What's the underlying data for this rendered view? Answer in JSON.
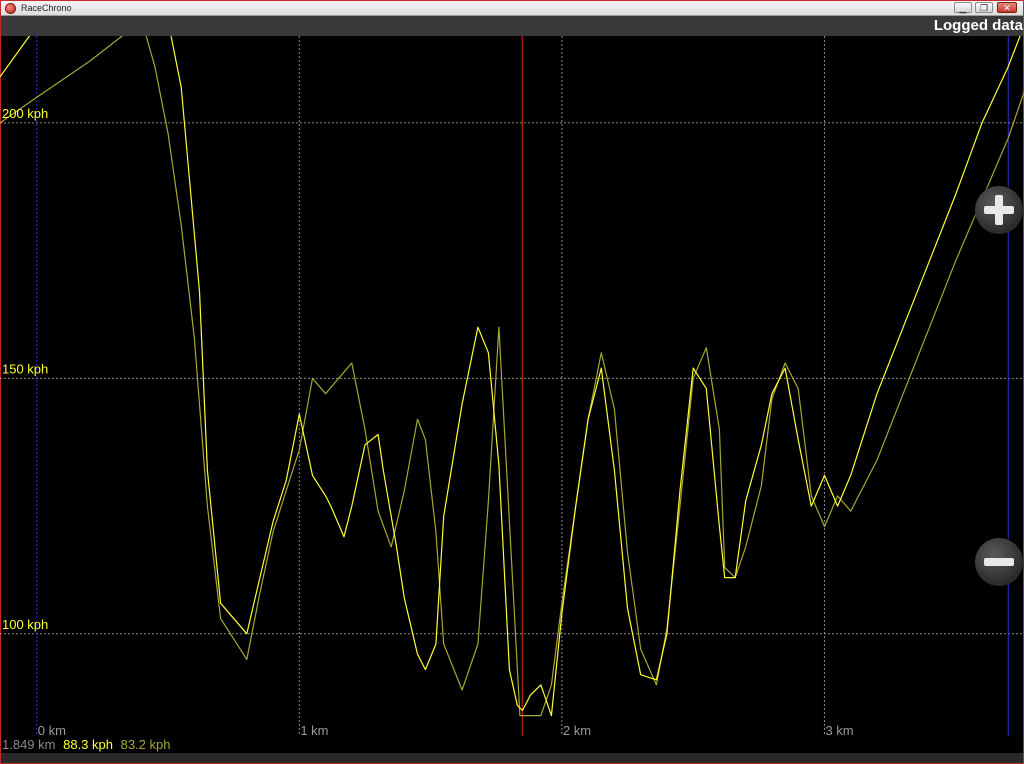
{
  "window": {
    "title": "RaceChrono",
    "minimize_glyph": "▁",
    "restore_glyph": "❐",
    "close_glyph": "✕"
  },
  "header": {
    "title": "Logged data"
  },
  "readout": {
    "distance": "1.849 km",
    "speed_current": "88.3 kph",
    "speed_compare": "83.2 kph"
  },
  "zoom": {
    "in_icon": "plus-icon",
    "out_icon": "minus-icon"
  },
  "colors": {
    "primary_trace": "#ffff33",
    "compare_trace": "#a7a734",
    "cursor": "#e52a1a",
    "lap_marker": "#2b33d0",
    "grid": "#8c8c8c"
  },
  "chart_data": {
    "type": "line",
    "title": "",
    "xlabel": "",
    "ylabel": "",
    "xlim": [
      -0.14,
      3.76
    ],
    "ylim": [
      80,
      217
    ],
    "grid": true,
    "x_ticks": [
      {
        "value": 0,
        "label": "0 km"
      },
      {
        "value": 1,
        "label": "1 km"
      },
      {
        "value": 2,
        "label": "2 km"
      },
      {
        "value": 3,
        "label": "3 km"
      }
    ],
    "y_ticks": [
      {
        "value": 100,
        "label": "100 kph"
      },
      {
        "value": 150,
        "label": "150 kph"
      },
      {
        "value": 200,
        "label": "200 kph"
      }
    ],
    "cursor_x": 1.849,
    "lap_markers": [
      0.0,
      3.7
    ],
    "series": [
      {
        "role": "current",
        "x": [
          -0.14,
          0.0,
          0.2,
          0.4,
          0.45,
          0.5,
          0.55,
          0.58,
          0.62,
          0.65,
          0.7,
          0.8,
          0.85,
          0.9,
          0.95,
          1.0,
          1.05,
          1.1,
          1.12,
          1.17,
          1.2,
          1.25,
          1.3,
          1.32,
          1.37,
          1.4,
          1.45,
          1.48,
          1.52,
          1.55,
          1.62,
          1.68,
          1.72,
          1.76,
          1.8,
          1.83,
          1.85,
          1.88,
          1.92,
          1.96,
          2.0,
          2.05,
          2.1,
          2.15,
          2.2,
          2.25,
          2.3,
          2.36,
          2.4,
          2.45,
          2.5,
          2.55,
          2.6,
          2.62,
          2.66,
          2.7,
          2.76,
          2.8,
          2.85,
          2.9,
          2.95,
          3.0,
          3.05,
          3.1,
          3.2,
          3.3,
          3.4,
          3.5,
          3.6,
          3.7,
          3.76
        ],
        "y": [
          209,
          219,
          228,
          237,
          232,
          220,
          207,
          190,
          167,
          132,
          106,
          100,
          111,
          122,
          130,
          143,
          131,
          127,
          125,
          119,
          125,
          137,
          139,
          132,
          117,
          107,
          96,
          93,
          98,
          123,
          145,
          160,
          155,
          133,
          93,
          86,
          85,
          88,
          90,
          84,
          104,
          124,
          142,
          152,
          132,
          105,
          92,
          91,
          100,
          128,
          152,
          148,
          121,
          111,
          111,
          126,
          137,
          147,
          152,
          138,
          125,
          131,
          125,
          131,
          147,
          160,
          173,
          186,
          200,
          211,
          219
        ]
      },
      {
        "role": "comparison",
        "x": [
          -0.14,
          0.0,
          0.2,
          0.4,
          0.45,
          0.5,
          0.55,
          0.6,
          0.65,
          0.7,
          0.8,
          0.85,
          0.9,
          0.95,
          1.0,
          1.05,
          1.1,
          1.15,
          1.2,
          1.25,
          1.3,
          1.35,
          1.4,
          1.45,
          1.48,
          1.52,
          1.55,
          1.62,
          1.68,
          1.72,
          1.76,
          1.8,
          1.84,
          1.88,
          1.92,
          1.96,
          2.0,
          2.05,
          2.1,
          2.15,
          2.2,
          2.25,
          2.3,
          2.36,
          2.4,
          2.45,
          2.5,
          2.55,
          2.6,
          2.62,
          2.66,
          2.7,
          2.76,
          2.8,
          2.85,
          2.9,
          2.95,
          3.0,
          3.05,
          3.1,
          3.2,
          3.3,
          3.4,
          3.5,
          3.6,
          3.7,
          3.76
        ],
        "y": [
          200,
          205,
          212,
          220,
          211,
          198,
          180,
          158,
          125,
          103,
          95,
          108,
          120,
          128,
          136,
          150,
          147,
          150,
          153,
          140,
          124,
          117,
          128,
          142,
          138,
          120,
          98,
          89,
          98,
          126,
          160,
          122,
          84,
          84,
          84,
          90,
          106,
          124,
          142,
          155,
          144,
          116,
          97,
          90,
          101,
          125,
          150,
          156,
          140,
          113,
          111,
          117,
          129,
          146,
          153,
          148,
          127,
          121,
          127,
          124,
          134,
          147,
          160,
          173,
          185,
          197,
          206
        ]
      }
    ]
  }
}
